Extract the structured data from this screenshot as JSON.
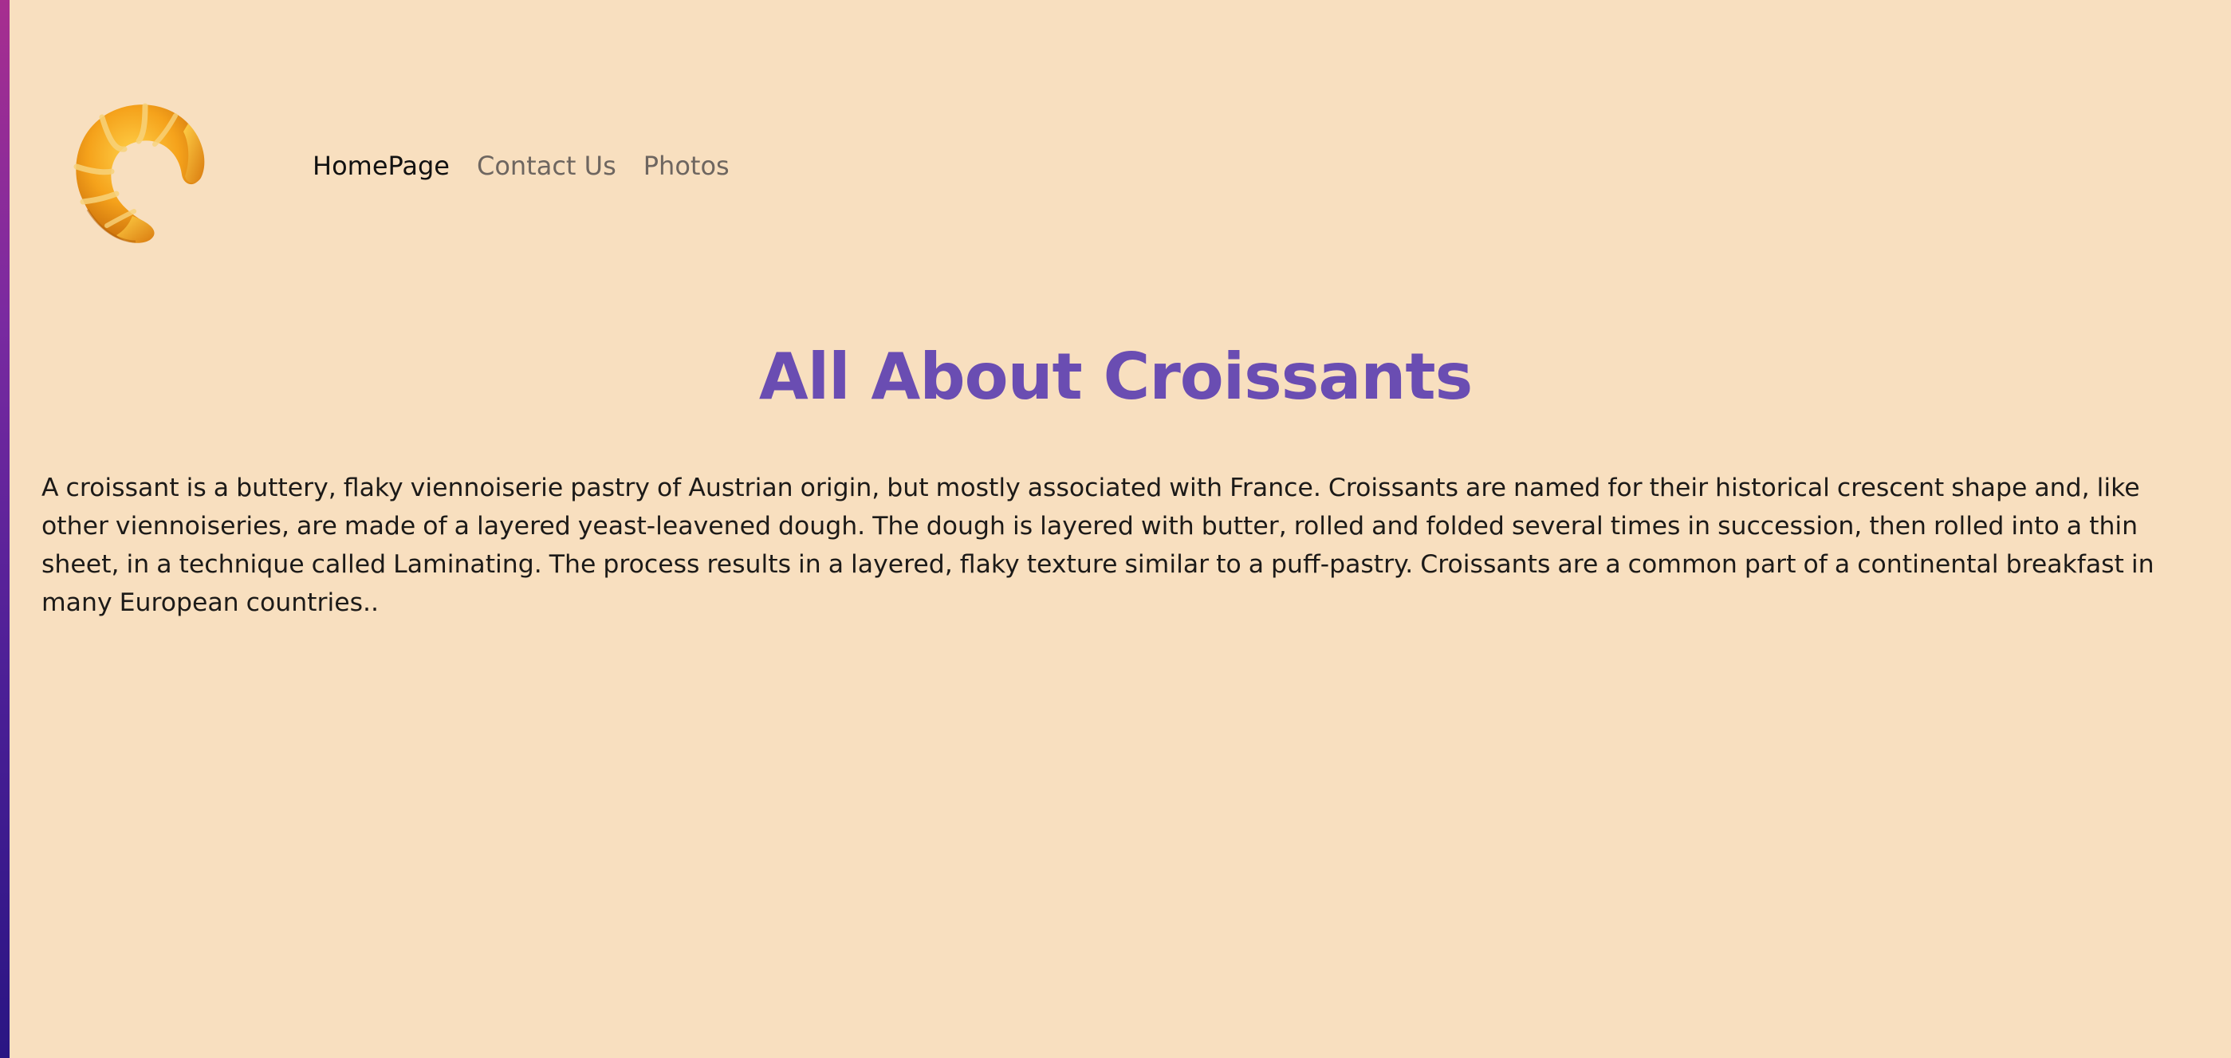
{
  "colors": {
    "background": "#f8dfbf",
    "title": "#6a4db2",
    "nav_active": "#111111",
    "nav_inactive": "#6e6660",
    "body_text": "#1c1a18"
  },
  "header": {
    "logo_icon": "croissant-icon",
    "nav": [
      {
        "label": "HomePage",
        "active": true
      },
      {
        "label": "Contact Us",
        "active": false
      },
      {
        "label": "Photos",
        "active": false
      }
    ]
  },
  "main": {
    "title": "All About Croissants",
    "paragraph": "A croissant is a buttery, flaky viennoiserie pastry of Austrian origin, but mostly associated with France. Croissants are named for their historical crescent shape and, like other viennoiseries, are made of a layered yeast-leavened dough. The dough is layered with butter, rolled and folded several times in succession, then rolled into a thin sheet, in a technique called Laminating. The process results in a layered, flaky texture similar to a puff-pastry. Croissants are a common part of a continental breakfast in many European countries.."
  }
}
